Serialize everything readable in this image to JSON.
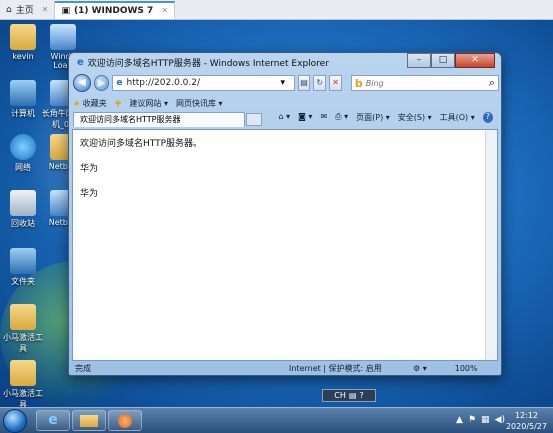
{
  "host": {
    "home_tab": "主页",
    "vm_tab": "(1) WINDOWS 7"
  },
  "desktop": {
    "icons": [
      {
        "label": "kevin",
        "icon": "user-folder-icon"
      },
      {
        "label": "Windo Load",
        "icon": "app-icon"
      },
      {
        "label": "计算机",
        "icon": "computer-icon"
      },
      {
        "label": "长角牛网 控机_01",
        "icon": "app-icon"
      },
      {
        "label": "网络",
        "icon": "network-icon"
      },
      {
        "label": "Netbox",
        "icon": "folder-icon"
      },
      {
        "label": "回收站",
        "icon": "recycle-bin-icon"
      },
      {
        "label": "Netbox",
        "icon": "app-icon"
      },
      {
        "label": "文件夹",
        "icon": "app-icon"
      },
      {
        "label": "小马激活工具",
        "icon": "folder-icon"
      },
      {
        "label": "小马激活工具",
        "icon": "folder-icon"
      }
    ]
  },
  "ie": {
    "title": "欢迎访问多域名HTTP服务器 - Windows Internet Explorer",
    "address": "http://202.0.0.2/",
    "search_placeholder": "Bing",
    "favorites": "收藏夹",
    "suggested_sites": "建议网站 ▾",
    "web_slice": "网页快讯库 ▾",
    "tab_title": "欢迎访问多域名HTTP服务器",
    "cmd": {
      "page": "页面(P) ▾",
      "safety": "安全(S) ▾",
      "tools": "工具(O) ▾",
      "help": "?"
    },
    "content": {
      "line1": "欢迎访问多域名HTTP服务器。",
      "line2": "华为",
      "line3": "华为"
    },
    "status": {
      "done": "完成",
      "zone": "Internet | 保护模式: 启用",
      "zoom": "100%"
    }
  },
  "taskbar": {
    "time": "12:12",
    "date": "2020/5/27",
    "lang": "CH"
  },
  "colors": {
    "desktop": "#1f70c2",
    "taskbar": "#2a4f7b",
    "window_frame": "#b9d4ef"
  }
}
